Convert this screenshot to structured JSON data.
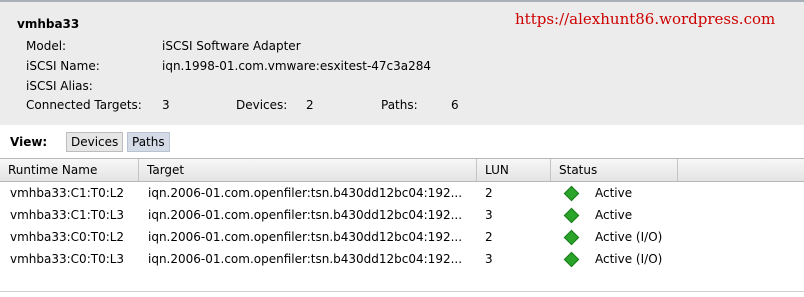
{
  "watermark": "https://alexhunt86.wordpress.com",
  "adapter": {
    "title": "vmhba33",
    "model_label": "Model:",
    "model_value": "iSCSI Software Adapter",
    "iscsi_name_label": "iSCSI Name:",
    "iscsi_name_value": "iqn.1998-01.com.vmware:esxitest-47c3a284",
    "iscsi_alias_label": "iSCSI Alias:",
    "iscsi_alias_value": "",
    "connected_targets_label": "Connected Targets:",
    "connected_targets_value": "3",
    "devices_label": "Devices:",
    "devices_value": "2",
    "paths_label": "Paths:",
    "paths_value": "6"
  },
  "view": {
    "label": "View:",
    "devices_button": "Devices",
    "paths_button": "Paths",
    "selected": "Paths"
  },
  "table": {
    "columns": [
      "Runtime Name",
      "Target",
      "LUN",
      "Status"
    ],
    "rows": [
      {
        "runtime": "vmhba33:C1:T0:L2",
        "target": "iqn.2006-01.com.openfiler:tsn.b430dd12bc04:192...",
        "lun": "2",
        "status": "Active",
        "status_icon": "green-diamond-icon"
      },
      {
        "runtime": "vmhba33:C1:T0:L3",
        "target": "iqn.2006-01.com.openfiler:tsn.b430dd12bc04:192...",
        "lun": "3",
        "status": "Active",
        "status_icon": "green-diamond-icon"
      },
      {
        "runtime": "vmhba33:C0:T0:L2",
        "target": "iqn.2006-01.com.openfiler:tsn.b430dd12bc04:192...",
        "lun": "2",
        "status": "Active (I/O)",
        "status_icon": "green-diamond-icon"
      },
      {
        "runtime": "vmhba33:C0:T0:L3",
        "target": "iqn.2006-01.com.openfiler:tsn.b430dd12bc04:192...",
        "lun": "3",
        "status": "Active (I/O)",
        "status_icon": "green-diamond-icon"
      }
    ]
  },
  "colors": {
    "status_active": "#2aa52a",
    "watermark": "#cc0000",
    "details_background": "#ececec"
  }
}
